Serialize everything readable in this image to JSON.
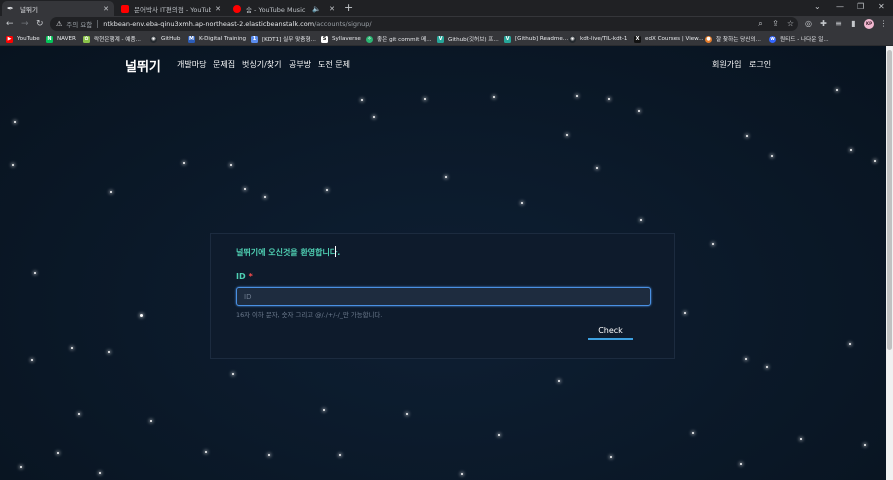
{
  "browser": {
    "tabs": [
      {
        "title": "널뛰기",
        "active": true,
        "favicon_color": "#202124",
        "favicon_glyph": "✒"
      },
      {
        "title": "문어박사 IT편의점 - YouTube",
        "active": false,
        "favicon_color": "#ff0000"
      },
      {
        "title": "숨 - YouTube Music",
        "active": false,
        "favicon_color": "#ff0000"
      }
    ],
    "omnibox": {
      "warning": "⚠",
      "security_label": "주의 요함",
      "host": "ntkbean-env.eba-qinu3xmh.ap-northeast-2.elasticbeanstalk.com",
      "path": "/accounts/signup/"
    },
    "profile_initials": "KP",
    "bookmarks": [
      {
        "label": "YouTube",
        "color": "#ff0000"
      },
      {
        "label": "NAVER",
        "color": "#03c75a"
      },
      {
        "label": "락현은행계 - 예품...",
        "color": "#8bc34a"
      },
      {
        "label": "GitHub",
        "color": "#24292e"
      },
      {
        "label": "K-Digital Training",
        "color": "#2b5cb8"
      },
      {
        "label": "[KDT1] 실무 맞춤형...",
        "color": "#5b8def"
      },
      {
        "label": "Syllaverse",
        "color": "#222222"
      },
      {
        "label": "좋은 git commit 메...",
        "color": "#2bb673"
      },
      {
        "label": "Github(깃허브) 프...",
        "color": "#26a69a"
      },
      {
        "label": "[Github] Readme...",
        "color": "#26a69a"
      },
      {
        "label": "kdt-live/TIL-kdt-1",
        "color": "#24292e"
      },
      {
        "label": "edX Courses | View...",
        "color": "#111111"
      },
      {
        "label": "잘 찾하는 당신의...",
        "color": "#e57c2a"
      },
      {
        "label": "원티드 - 나다운 일...",
        "color": "#3366ff"
      }
    ]
  },
  "site": {
    "logo": "널뛰기",
    "menu": [
      "개발마당",
      "문제집",
      "벗싱기/찾기",
      "공부방",
      "도전 문제"
    ],
    "right_menu": [
      "회원가입",
      "로그인"
    ]
  },
  "signup": {
    "welcome": "널뛰기에 오신것을 환영합니다.",
    "id_label": "ID",
    "required_mark": "*",
    "id_placeholder": "ID",
    "id_value": "",
    "hint": "16자 이하 문자, 숫자 그리고 @/./+/-/_만 가능합니다.",
    "check_button": "Check",
    "accent_color": "#4fd1b4",
    "input_border_color": "#4a90e2"
  }
}
